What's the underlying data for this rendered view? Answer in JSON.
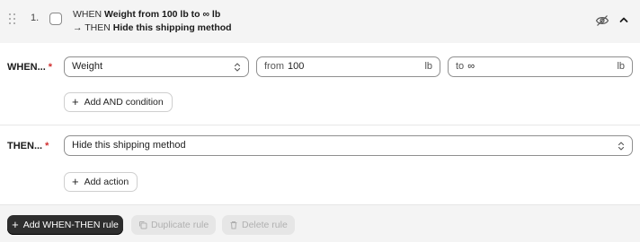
{
  "rule": {
    "number": "1.",
    "summary_when_prefix": "WHEN",
    "summary_when_bold": "Weight from 100 lb to ∞ lb",
    "summary_then_prefix": "→ THEN",
    "summary_then_bold": "Hide this shipping method"
  },
  "when": {
    "label": "WHEN...",
    "required_mark": "*",
    "condition_select": "Weight",
    "from_prefix": "from",
    "from_value": "100",
    "from_unit": "lb",
    "to_prefix": "to",
    "to_value": "∞",
    "to_unit": "lb",
    "add_and_label": "Add AND condition"
  },
  "then": {
    "label": "THEN...",
    "required_mark": "*",
    "action_select": "Hide this shipping method",
    "add_action_label": "Add action"
  },
  "footer": {
    "add_rule_label": "Add WHEN-THEN rule",
    "duplicate_label": "Duplicate rule",
    "delete_label": "Delete rule"
  },
  "icons": [
    "drag-handle-icon",
    "hidden-eye-icon",
    "chevron-up-icon",
    "chevron-up-down-icon",
    "plus-icon",
    "duplicate-icon",
    "trash-icon"
  ],
  "colors": {
    "required": "#d12f2f",
    "primary_button": "#2e2e2e",
    "header_bg": "#f4f4f4"
  }
}
